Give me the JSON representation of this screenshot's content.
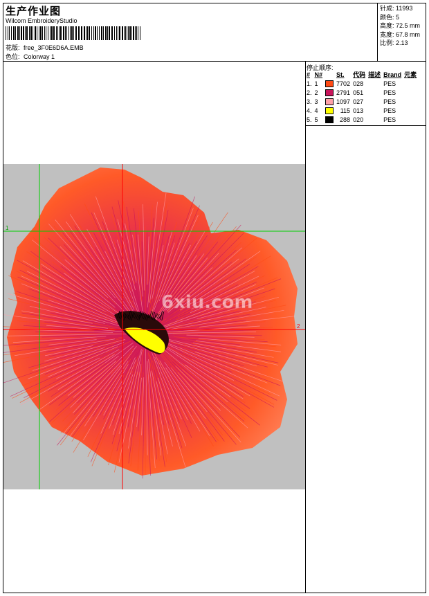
{
  "header": {
    "title": "生产作业图",
    "software": "Wilcom EmbroideryStudio",
    "design_label": "花版:",
    "design_file": "free_3F0E6D6A.EMB",
    "colorway_label": "色位:",
    "colorway": "Colorway 1"
  },
  "stats": {
    "stitches_label": "针成:",
    "stitches": "11993",
    "colors_label": "颜色:",
    "colors": "5",
    "height_label": "高度:",
    "height": "72.5 mm",
    "width_label": "宽度:",
    "width": "67.8 mm",
    "ratio_label": "比例:",
    "ratio": "2.13"
  },
  "sequence": {
    "title": "停止顺序:",
    "headers": [
      "#",
      "N#",
      "St.",
      "代码",
      "描述",
      "Brand",
      "元素"
    ],
    "rows": [
      {
        "num": "1.",
        "n": "1",
        "color": "#ff4a14",
        "st": "7702",
        "code": "028",
        "brand": "PES"
      },
      {
        "num": "2.",
        "n": "2",
        "color": "#c8145a",
        "st": "2791",
        "code": "051",
        "brand": "PES"
      },
      {
        "num": "3.",
        "n": "3",
        "color": "#ffa0a8",
        "st": "1097",
        "code": "027",
        "brand": "PES"
      },
      {
        "num": "4.",
        "n": "4",
        "color": "#ffff00",
        "st": "115",
        "code": "013",
        "brand": "PES"
      },
      {
        "num": "5.",
        "n": "5",
        "color": "#000000",
        "st": "288",
        "code": "020",
        "brand": "PES"
      }
    ]
  },
  "preview": {
    "background_color": "#c0c0c0",
    "marker_1": "1",
    "marker_2": "2",
    "watermark": "6xiu.com"
  }
}
